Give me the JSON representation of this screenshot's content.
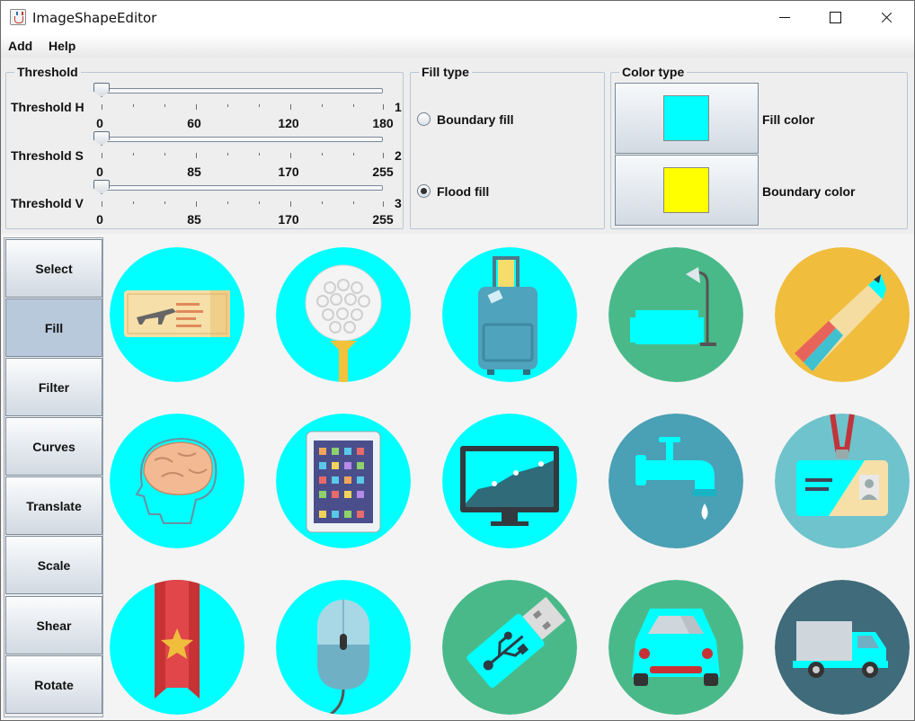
{
  "window": {
    "title": "ImageShapeEditor"
  },
  "menu": {
    "items": [
      "Add",
      "Help"
    ]
  },
  "threshold": {
    "title": "Threshold",
    "sliders": [
      {
        "label": "Threshold H",
        "value": "1",
        "ticks": [
          "0",
          "60",
          "120",
          "180"
        ]
      },
      {
        "label": "Threshold S",
        "value": "2",
        "ticks": [
          "0",
          "85",
          "170",
          "255"
        ]
      },
      {
        "label": "Threshold V",
        "value": "3",
        "ticks": [
          "0",
          "85",
          "170",
          "255"
        ]
      }
    ]
  },
  "fill_type": {
    "title": "Fill type",
    "options": [
      {
        "label": "Boundary fill",
        "checked": false
      },
      {
        "label": "Flood fill",
        "checked": true
      }
    ]
  },
  "color_type": {
    "title": "Color type",
    "fill": {
      "label": "Fill color",
      "color": "#00ffff"
    },
    "boundary": {
      "label": "Boundary color",
      "color": "#ffff00"
    }
  },
  "tools": {
    "items": [
      "Select",
      "Fill",
      "Filter",
      "Curves",
      "Translate",
      "Scale",
      "Shear",
      "Rotate"
    ],
    "active": "Fill"
  },
  "icons": [
    {
      "name": "ticket",
      "bg": "#00ffff"
    },
    {
      "name": "golf-ball",
      "bg": "#00ffff"
    },
    {
      "name": "suitcase",
      "bg": "#00ffff"
    },
    {
      "name": "sofa-lamp",
      "bg": "#4ab98a"
    },
    {
      "name": "pencil",
      "bg": "#f0bd3c"
    },
    {
      "name": "brain-head",
      "bg": "#00ffff"
    },
    {
      "name": "tablet",
      "bg": "#00ffff"
    },
    {
      "name": "monitor-chart",
      "bg": "#00ffff"
    },
    {
      "name": "water-tap",
      "bg": "#4aa0b4"
    },
    {
      "name": "id-badge",
      "bg": "#6fc3cc"
    },
    {
      "name": "bookmark-star",
      "bg": "#00ffff"
    },
    {
      "name": "computer-mouse",
      "bg": "#00ffff"
    },
    {
      "name": "usb-drive",
      "bg": "#4ab98a"
    },
    {
      "name": "car",
      "bg": "#4ab98a"
    },
    {
      "name": "truck",
      "bg": "#3f6b7a"
    }
  ]
}
